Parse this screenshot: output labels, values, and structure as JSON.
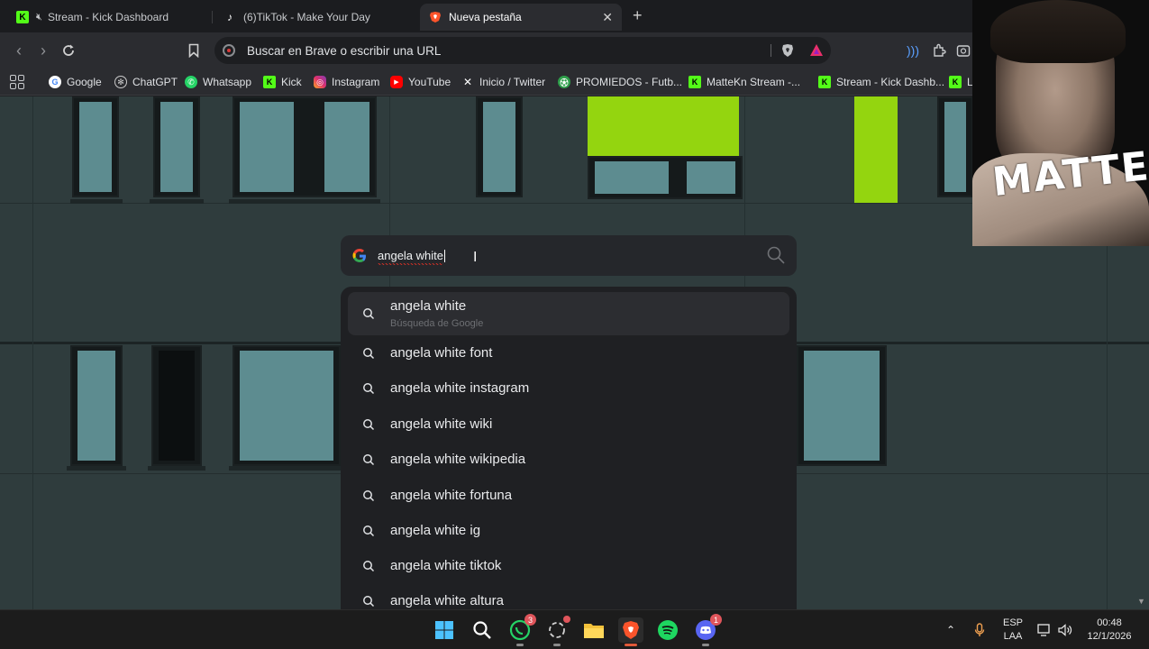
{
  "tabs": [
    {
      "title": "Stream - Kick Dashboard",
      "icon": "kick-icon"
    },
    {
      "title": "(6)TikTok - Make Your Day",
      "icon": "tiktok-icon"
    },
    {
      "title": "Nueva pestaña",
      "icon": "brave-icon",
      "active": true
    }
  ],
  "new_tab_label": "+",
  "toolbar": {
    "omnibox_placeholder": "Buscar en Brave o escribir una URL"
  },
  "bookmarks": [
    {
      "label": "Google",
      "icon": "google-icon"
    },
    {
      "label": "ChatGPT",
      "icon": "chatgpt-icon"
    },
    {
      "label": "Whatsapp",
      "icon": "whatsapp-icon"
    },
    {
      "label": "Kick",
      "icon": "kick-icon"
    },
    {
      "label": "Instagram",
      "icon": "instagram-icon"
    },
    {
      "label": "YouTube",
      "icon": "youtube-icon"
    },
    {
      "label": "Inicio / Twitter",
      "icon": "x-icon"
    },
    {
      "label": "PROMIEDOS - Futb...",
      "icon": "promiedos-icon"
    },
    {
      "label": "MatteKn Stream -...",
      "icon": "kick-icon"
    },
    {
      "label": "Stream - Kick Dashb...",
      "icon": "kick-icon"
    },
    {
      "label": "L",
      "icon": "kick-icon"
    }
  ],
  "search": {
    "query": "angela white"
  },
  "suggestions": [
    {
      "text": "angela white",
      "sub": "Búsqueda de Google"
    },
    {
      "text": "angela white font"
    },
    {
      "text": "angela white instagram"
    },
    {
      "text": "angela white wiki"
    },
    {
      "text": "angela white wikipedia"
    },
    {
      "text": "angela white fortuna"
    },
    {
      "text": "angela white ig"
    },
    {
      "text": "angela white tiktok"
    },
    {
      "text": "angela white altura"
    }
  ],
  "webcam": {
    "signature": "MATTE"
  },
  "taskbar": {
    "apps": [
      {
        "name": "windows-start-icon"
      },
      {
        "name": "search-icon"
      },
      {
        "name": "whatsapp-icon",
        "badge": "3"
      },
      {
        "name": "chatgpt-icon"
      },
      {
        "name": "file-explorer-icon"
      },
      {
        "name": "brave-icon"
      },
      {
        "name": "spotify-icon"
      },
      {
        "name": "discord-icon",
        "badge": "1"
      }
    ],
    "lang_top": "ESP",
    "lang_bottom": "LAA",
    "time": "00:48",
    "date": "12/1/2026"
  },
  "colors": {
    "kick_green": "#53fc18",
    "brave_orange": "#fb542b",
    "wall": "#2f3c3d",
    "lime_panel": "#94d50f"
  }
}
